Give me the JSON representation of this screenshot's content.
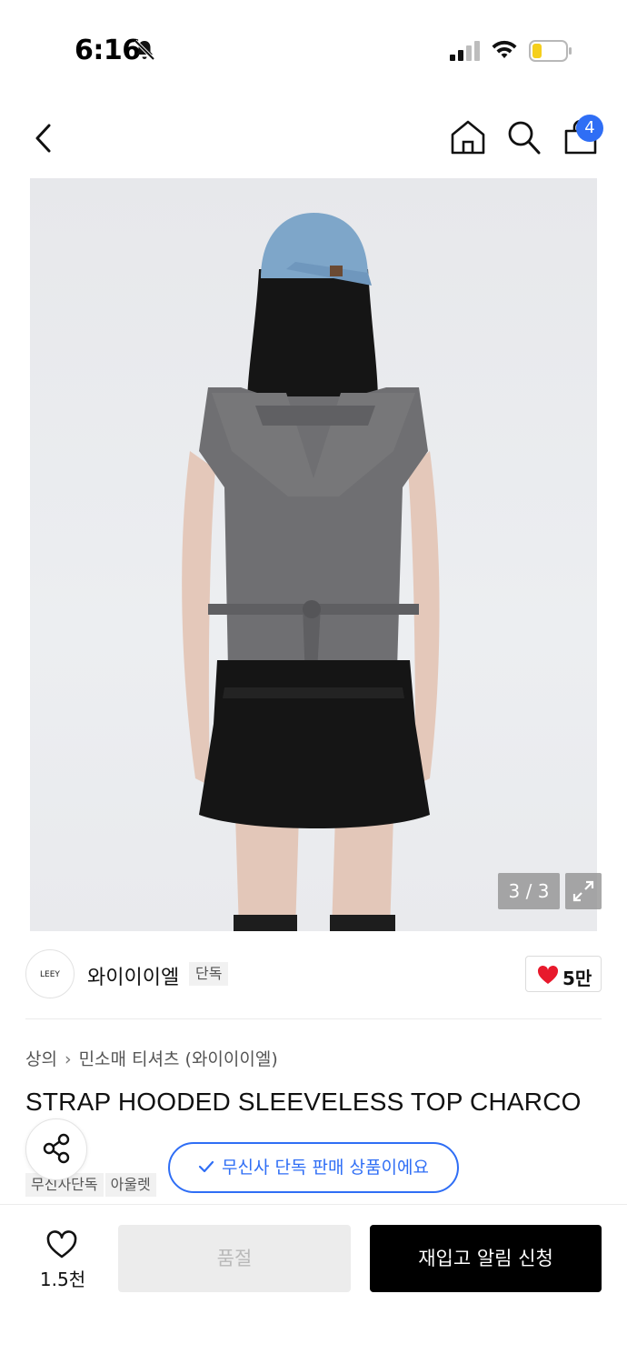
{
  "status_bar": {
    "time": "6:16",
    "icons": [
      "bell-slash-icon",
      "signal-icon",
      "wifi-icon",
      "battery-icon"
    ]
  },
  "header": {
    "icons": [
      "back-icon",
      "home-icon",
      "search-icon",
      "cart-icon"
    ],
    "cart_badge": "4"
  },
  "gallery": {
    "counter": "3 / 3",
    "expand_icon": "expand-icon"
  },
  "brand": {
    "logo_text": "LEEY",
    "name": "와이이이엘",
    "tag": "단독",
    "likes": "5만"
  },
  "breadcrumb": {
    "category": "상의",
    "subcategory": "민소매 티셔츠 (와이이이엘)"
  },
  "product": {
    "title": "STRAP HOODED SLEEVELESS TOP CHARCO",
    "exclusive_notice": "무신사 단독 판매 상품이에요",
    "tags": [
      "무신사단독",
      "아울렛"
    ]
  },
  "bottom_bar": {
    "wish_count": "1.5천",
    "soldout_label": "품절",
    "restock_label": "재입고 알림 신청"
  },
  "colors": {
    "accent_blue": "#2f6ef5",
    "heart_red": "#e8192c",
    "primary_black": "#000000"
  }
}
